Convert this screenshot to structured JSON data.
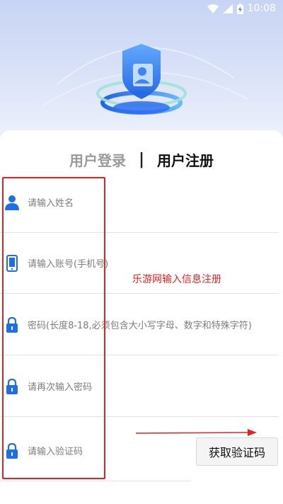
{
  "status_bar": {
    "time": "10:08"
  },
  "tabs": {
    "login": "用户登录",
    "separator": "|",
    "register": "用户注册"
  },
  "fields": [
    {
      "icon": "person-icon",
      "placeholder": "请输入姓名"
    },
    {
      "icon": "phone-icon",
      "placeholder": "请输入账号(手机号)"
    },
    {
      "icon": "lock-icon",
      "placeholder": "密码(长度8-18,必须包含大小写字母、数字和特殊字符)"
    },
    {
      "icon": "lock-icon",
      "placeholder": "请再次输入密码"
    },
    {
      "icon": "lock-icon",
      "placeholder": "请输入验证码"
    }
  ],
  "get_code_button": "获取验证码",
  "annotation": {
    "text": "乐游网输入信息注册"
  },
  "colors": {
    "accent": "#1c6fe8",
    "annotation": "#e52222"
  }
}
